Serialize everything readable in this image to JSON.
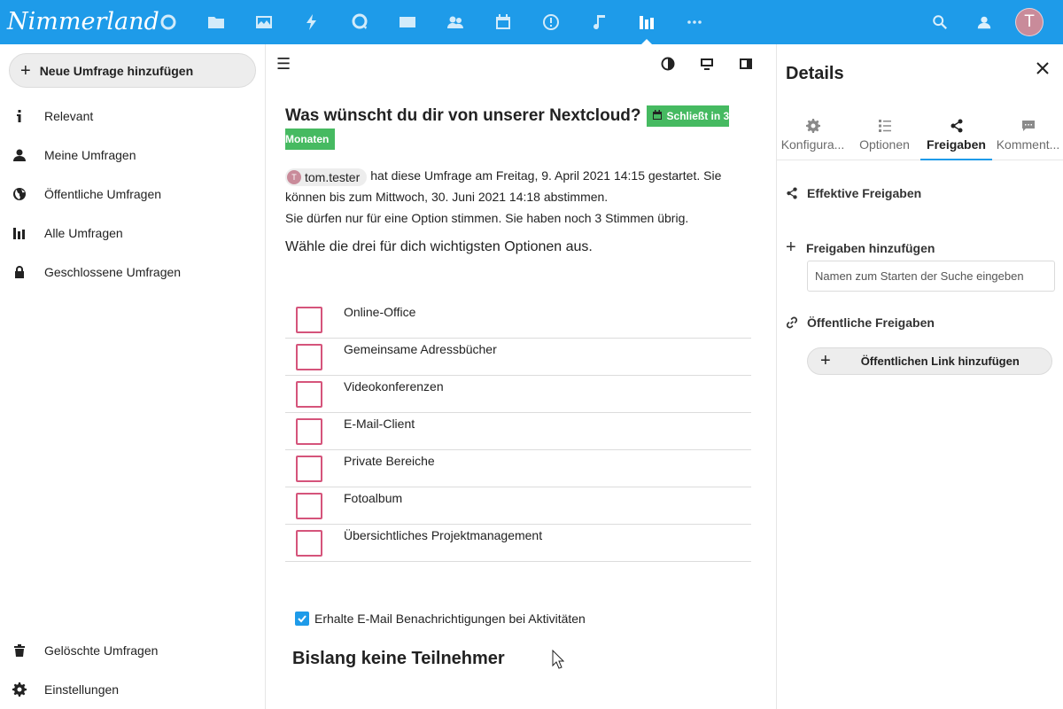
{
  "header": {
    "logo": "Nimmerland",
    "apps": [
      "dashboard",
      "files",
      "photos",
      "activity",
      "talk",
      "mail",
      "contacts",
      "calendar",
      "deck",
      "music",
      "polls",
      "more"
    ],
    "active_app": "polls",
    "avatar_letter": "T"
  },
  "nav": {
    "new_poll": "Neue Umfrage hinzufügen",
    "items": [
      {
        "label": "Relevant",
        "icon": "info-icon"
      },
      {
        "label": "Meine Umfragen",
        "icon": "user-icon"
      },
      {
        "label": "Öffentliche Umfragen",
        "icon": "globe-icon"
      },
      {
        "label": "Alle Umfragen",
        "icon": "poll-icon"
      },
      {
        "label": "Geschlossene Umfragen",
        "icon": "lock-icon"
      }
    ],
    "bottom": [
      {
        "label": "Gelöschte Umfragen",
        "icon": "trash-icon"
      },
      {
        "label": "Einstellungen",
        "icon": "gear-icon"
      }
    ]
  },
  "poll": {
    "title": "Was wünscht du dir von unserer Nextcloud?",
    "badge_line1": "Schließt in 3",
    "badge_line2": "Monaten",
    "owner": "tom.tester",
    "owner_initial": "T",
    "meta_line1": "hat diese Umfrage am Freitag, 9. April 2021 14:15 gestartet. Sie",
    "meta_line2": "können bis zum Mittwoch, 30. Juni 2021 14:18 abstimmen.",
    "meta_line3": "Sie dürfen nur für eine Option stimmen. Sie haben noch 3 Stimmen übrig.",
    "description": "Wähle die drei für dich wichtigsten Optionen aus.",
    "options": [
      "Online-Office",
      "Gemeinsame Adressbücher",
      "Videokonferenzen",
      "E-Mail-Client",
      "Private Bereiche",
      "Fotoalbum",
      "Übersichtliches Projektmanagement"
    ],
    "notify_label": "Erhalte E-Mail Benachrichtigungen bei Aktivitäten",
    "notify_checked": true,
    "no_participants": "Bislang keine Teilnehmer"
  },
  "sidebar": {
    "title": "Details",
    "tabs": [
      {
        "label": "Konfigura...",
        "icon": "gear-icon"
      },
      {
        "label": "Optionen",
        "icon": "list-icon"
      },
      {
        "label": "Freigaben",
        "icon": "share-icon"
      },
      {
        "label": "Komment...",
        "icon": "comment-icon"
      }
    ],
    "active_tab": "Freigaben",
    "effective_shares": "Effektive Freigaben",
    "add_shares": "Freigaben hinzufügen",
    "search_placeholder": "Namen zum Starten der Suche eingeben",
    "public_shares": "Öffentliche Freigaben",
    "add_public_link": "Öffentlichen Link hinzufügen"
  },
  "colors": {
    "header_bg": "#1e9be9",
    "badge_green": "#46ba61",
    "option_border": "#d5547b",
    "accent": "#1e9be9"
  }
}
